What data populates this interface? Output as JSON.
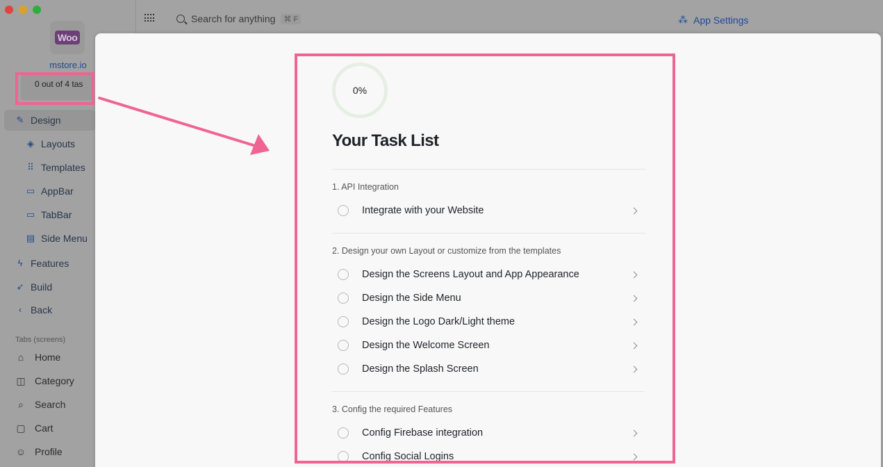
{
  "sidebar": {
    "logo_text": "Woo",
    "store_name": "mstore.io",
    "tasks_progress": "0 out of 4 tas",
    "nav": [
      {
        "label": "Design",
        "icon": "brush-icon"
      },
      {
        "label": "Layouts",
        "icon": "layers-icon"
      },
      {
        "label": "Templates",
        "icon": "grid-icon"
      },
      {
        "label": "AppBar",
        "icon": "appbar-icon"
      },
      {
        "label": "TabBar",
        "icon": "tabbar-icon"
      },
      {
        "label": "Side Menu",
        "icon": "sidemenu-icon"
      },
      {
        "label": "Features",
        "icon": "bolt-icon"
      },
      {
        "label": "Build",
        "icon": "rocket-icon"
      },
      {
        "label": "Back",
        "icon": "chevron-left-icon"
      }
    ],
    "tabs_section_title": "Tabs (screens)",
    "tabs": [
      {
        "label": "Home",
        "icon": "home-icon"
      },
      {
        "label": "Category",
        "icon": "category-icon"
      },
      {
        "label": "Search",
        "icon": "search-icon"
      },
      {
        "label": "Cart",
        "icon": "cart-icon"
      },
      {
        "label": "Profile",
        "icon": "profile-icon"
      }
    ]
  },
  "topbar": {
    "search_placeholder": "Search for anything",
    "search_shortcut": "⌘ F",
    "app_settings_label": "App Settings"
  },
  "task_panel": {
    "progress_text": "0%",
    "progress_value": 0,
    "title": "Your Task List",
    "sections": [
      {
        "label": "1. API Integration",
        "tasks": [
          "Integrate with your Website"
        ]
      },
      {
        "label": "2. Design your own Layout or customize from the templates",
        "tasks": [
          "Design the Screens Layout and App Appearance",
          "Design the Side Menu",
          "Design the Logo Dark/Light theme",
          "Design the Welcome Screen",
          "Design the Splash Screen"
        ]
      },
      {
        "label": "3. Config the required Features",
        "tasks": [
          "Config Firebase integration",
          "Config Social Logins"
        ]
      }
    ]
  },
  "colors": {
    "highlight": "#ef6493",
    "accent": "#1b4aa0",
    "progress_track": "#e5efe3"
  }
}
